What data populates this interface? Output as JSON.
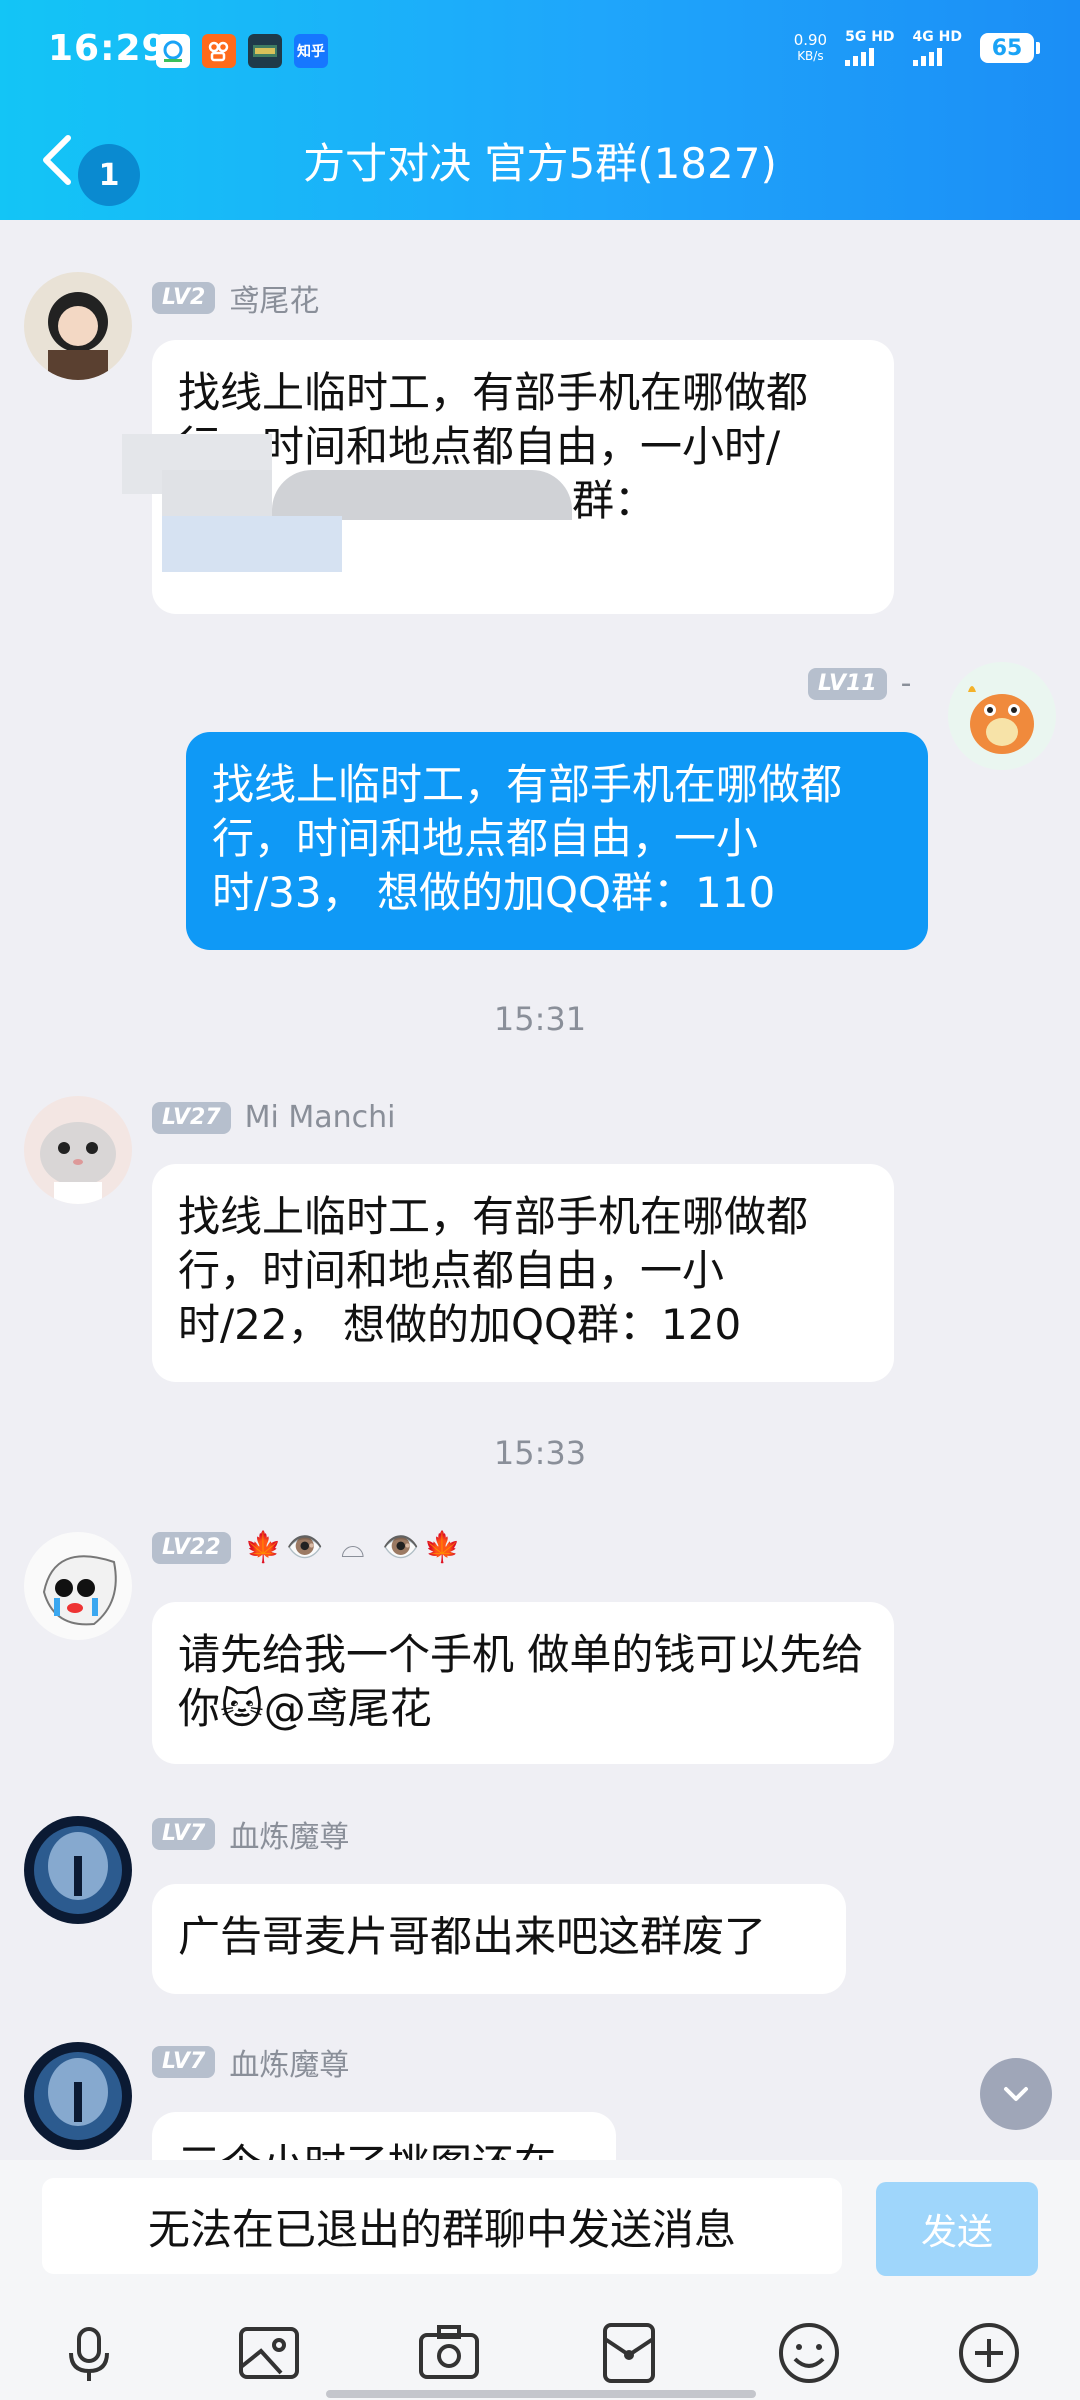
{
  "status_bar": {
    "time": "16:29",
    "net_speed": "0.90",
    "net_unit": "KB/s",
    "signal_1": "5G HD",
    "signal_2": "4G HD",
    "battery": "65",
    "notif_icons": [
      "app-store-icon",
      "kuaishou-icon",
      "game-icon",
      "zhihu-icon"
    ],
    "zhihu_label": "知乎"
  },
  "nav": {
    "unread_count": "1",
    "title": "方寸对决 官方5群(1827)"
  },
  "messages": [
    {
      "level": "LV2",
      "name": "鸢尾花",
      "text": "找线上临时工，有部手机在哪做都行，时间和地点都自由，一小时/",
      "text_tail": "群："
    },
    {
      "level": "LV11",
      "name": "-",
      "text": "找线上临时工，有部手机在哪做都行，时间和地点都自由，一小时/33， 想做的加QQ群：110"
    },
    {
      "time": "15:31"
    },
    {
      "level": "LV27",
      "name": "Mi Manchi",
      "text": "找线上临时工，有部手机在哪做都行，时间和地点都自由，一小时/22， 想做的加QQ群：120"
    },
    {
      "time": "15:33"
    },
    {
      "level": "LV22",
      "name": "🍁👁️ ⌓ 👁️🍁",
      "text": "请先给我一个手机 做单的钱可以先给你🐱@鸢尾花"
    },
    {
      "level": "LV7",
      "name": "血炼魔尊",
      "text": "广告哥麦片哥都出来吧这群废了"
    },
    {
      "level": "LV7",
      "name": "血炼魔尊",
      "text": "三个小时了挑图还在"
    }
  ],
  "input": {
    "placeholder": "无法在已退出的群聊中发送消息",
    "send_label": "发送"
  },
  "toolbar": [
    "microphone-icon",
    "image-icon",
    "camera-icon",
    "red-packet-icon",
    "emoji-icon",
    "plus-icon"
  ],
  "colors": {
    "header_start": "#13c5f6",
    "header_end": "#1b8ef6",
    "my_bubble": "#0f99f6",
    "background": "#efeff4",
    "send_button": "#9fd6fb"
  }
}
